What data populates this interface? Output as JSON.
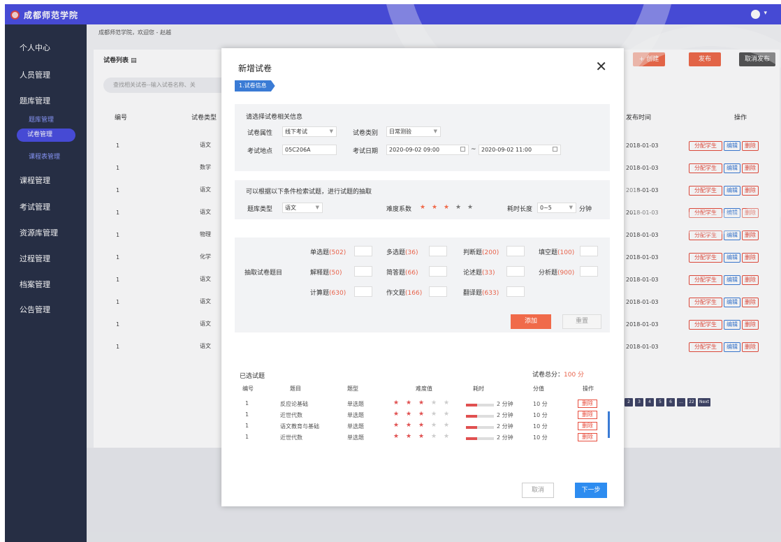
{
  "app": {
    "name": "成都师范学院",
    "colors": {
      "topbar": "#4a4ee0",
      "sidebar": "#283047",
      "accent": "#f06a4a",
      "link": "#3a7bd5"
    }
  },
  "sidebar": {
    "items": [
      {
        "label": "个人中心"
      },
      {
        "label": "人员管理"
      },
      {
        "label": "题库管理"
      },
      {
        "label": "题库管理"
      },
      {
        "label": "试卷管理"
      },
      {
        "label": "课程表管理"
      },
      {
        "label": "课程管理"
      },
      {
        "label": "考试管理"
      },
      {
        "label": "资源库管理"
      },
      {
        "label": "过程管理"
      },
      {
        "label": "档案管理"
      },
      {
        "label": "公告管理"
      }
    ]
  },
  "breadcrumb": "成都师范学院，欢迎您 - 赵越",
  "list": {
    "title": "试卷列表",
    "search_placeholder": "查找相关试卷--输入试卷名称、关",
    "buttons": {
      "create": "+ 创建",
      "publish": "发布",
      "unpublish": "取消发布"
    },
    "headers": {
      "id": "编号",
      "type": "试卷类型",
      "time": "发布时间",
      "ops": "操作"
    },
    "rows": [
      {
        "id": "1",
        "type": "语文",
        "time": "2018-01-03"
      },
      {
        "id": "1",
        "type": "数学",
        "time": "2018-01-03"
      },
      {
        "id": "1",
        "type": "语文",
        "time": "2018-01-03"
      },
      {
        "id": "1",
        "type": "语文",
        "time": "2018-01-03"
      },
      {
        "id": "1",
        "type": "物理",
        "time": "2018-01-03"
      },
      {
        "id": "1",
        "type": "化学",
        "time": "2018-01-03"
      },
      {
        "id": "1",
        "type": "语文",
        "time": "2018-01-03"
      },
      {
        "id": "1",
        "type": "语文",
        "time": "2018-01-03"
      },
      {
        "id": "1",
        "type": "语文",
        "time": "2018-01-03"
      },
      {
        "id": "1",
        "type": "语文",
        "time": "2018-01-03"
      }
    ],
    "row_actions": {
      "assign": "分配学生",
      "edit": "编辑",
      "delete": "删除"
    },
    "pager": [
      "2",
      "3",
      "4",
      "5",
      "6",
      "...",
      "22",
      "Next"
    ]
  },
  "modal": {
    "title": "新增试卷",
    "close": "✕",
    "step": "1.试卷信息",
    "info": {
      "heading": "请选择试卷相关信息",
      "attr_label": "试卷属性",
      "attr_value": "线下考试",
      "cat_label": "试卷类别",
      "cat_value": "日常测验",
      "place_label": "考试地点",
      "place_value": "05C206A",
      "date_label": "考试日期",
      "date_start": "2020-09-02 09:00",
      "date_sep": "~",
      "date_end": "2020-09-02 11:00"
    },
    "filter": {
      "heading": "可以根据以下条件检索试题，进行试题的抽取",
      "bank_label": "题库类型",
      "bank_value": "语文",
      "difficulty_label": "难度系数",
      "difficulty_rating": 3,
      "difficulty_max": 5,
      "duration_label": "耗时长度",
      "duration_value": "0~5",
      "duration_unit": "分钟"
    },
    "extract": {
      "label": "抽取试卷题目",
      "types": [
        {
          "name": "单选题",
          "count": "(502)"
        },
        {
          "name": "多选题",
          "count": "(36)"
        },
        {
          "name": "判断题",
          "count": "(200)"
        },
        {
          "name": "填空题",
          "count": "(100)"
        },
        {
          "name": "解释题",
          "count": "(50)"
        },
        {
          "name": "简答题",
          "count": "(66)"
        },
        {
          "name": "论述题",
          "count": "(33)"
        },
        {
          "name": "分析题",
          "count": "(900)"
        },
        {
          "name": "计算题",
          "count": "(630)"
        },
        {
          "name": "作文题",
          "count": "(166)"
        },
        {
          "name": "翻译题",
          "count": "(633)"
        }
      ],
      "add": "添加",
      "reset": "重置"
    },
    "selected": {
      "heading": "已选试题",
      "total_label": "试卷总分：",
      "total_value": "100 分",
      "headers": {
        "id": "编号",
        "topic": "题目",
        "type": "题型",
        "difficulty": "难度值",
        "time": "耗时",
        "score": "分值",
        "ops": "操作"
      },
      "rows": [
        {
          "id": "1",
          "topic": "反应论基础",
          "type": "单选题",
          "stars": 3,
          "progress": 0.4,
          "time": "2 分钟",
          "score": "10 分",
          "op": "删除"
        },
        {
          "id": "1",
          "topic": "近世代数",
          "type": "单选题",
          "stars": 3,
          "progress": 0.4,
          "time": "2 分钟",
          "score": "10 分",
          "op": "删除"
        },
        {
          "id": "1",
          "topic": "语文教育与基础",
          "type": "单选题",
          "stars": 3,
          "progress": 0.4,
          "time": "2 分钟",
          "score": "10 分",
          "op": "删除"
        },
        {
          "id": "1",
          "topic": "近世代数",
          "type": "单选题",
          "stars": 3,
          "progress": 0.4,
          "time": "2 分钟",
          "score": "10 分",
          "op": "删除"
        }
      ]
    },
    "footer": {
      "cancel": "取消",
      "next": "下一步"
    }
  }
}
